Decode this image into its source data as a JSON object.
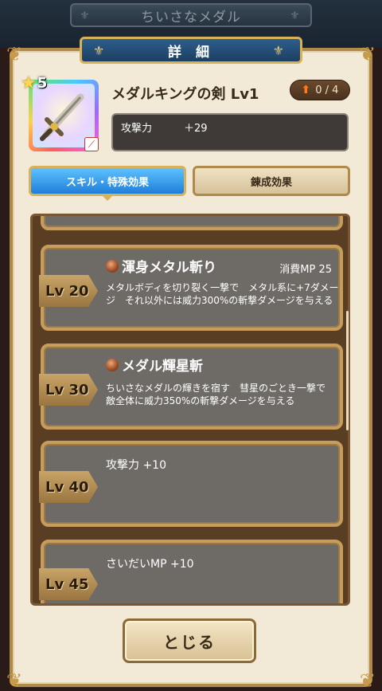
{
  "screen": {
    "header_title": "ちいさなメダル",
    "dialog_title": "詳 細"
  },
  "item": {
    "rarity": "5",
    "name": "メダルキングの剣 Lv1",
    "upgrade": "0 / 4",
    "stat_label": "攻撃力",
    "stat_value": "＋29"
  },
  "tabs": [
    {
      "label": "スキル・特殊効果",
      "active": true
    },
    {
      "label": "錬成効果",
      "active": false
    }
  ],
  "skills": [
    {
      "level": "Lv 20",
      "name": "渾身メタル斬り",
      "mp": "消費MP  25",
      "description": "メタルボディを切り裂く一撃で　メタル系に+7ダメージ　それ以外には威力300%の斬撃ダメージを与える"
    },
    {
      "level": "Lv 30",
      "name": "メダル輝星斬",
      "mp": "",
      "description": "ちいさなメダルの輝きを宿す　彗星のごとき一撃で　敵全体に威力350%の斬撃ダメージを与える"
    },
    {
      "level": "Lv 40",
      "text": "攻撃力 +10"
    },
    {
      "level": "Lv 45",
      "text": "さいだいMP +10"
    }
  ],
  "close_button": "とじる"
}
